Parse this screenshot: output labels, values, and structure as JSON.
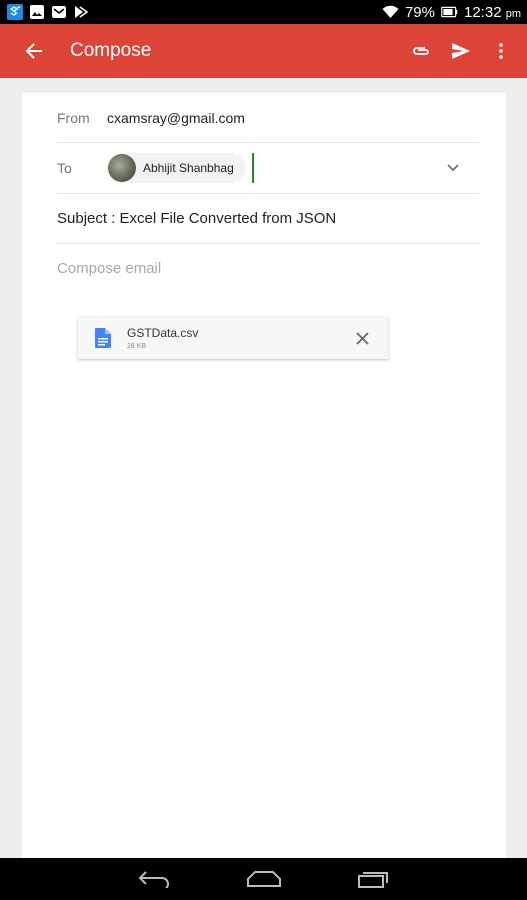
{
  "status_bar": {
    "battery": "79%",
    "time": "12:32",
    "ampm": "pm",
    "icons": [
      "dropbox-icon",
      "gallery-icon",
      "gmail-icon",
      "play-store-icon",
      "wifi-icon",
      "battery-icon"
    ]
  },
  "app_bar": {
    "title": "Compose",
    "icons": [
      "back-arrow-icon",
      "paperclip-icon",
      "send-icon",
      "more-vert-icon"
    ]
  },
  "compose": {
    "from_label": "From",
    "from_value": "cxamsray@gmail.com",
    "to_label": "To",
    "recipient_name": "Abhijit Shanbhag",
    "subject": "Subject : Excel File Converted from JSON",
    "body_placeholder": "Compose email"
  },
  "attachment": {
    "name": "GSTData.csv",
    "size": "28 KB"
  },
  "colors": {
    "accent": "#db4437",
    "file_icon": "#4285f4",
    "cursor": "#2e7d32"
  },
  "nav_bar": {
    "icons": [
      "back-nav-icon",
      "home-nav-icon",
      "recents-nav-icon"
    ]
  }
}
